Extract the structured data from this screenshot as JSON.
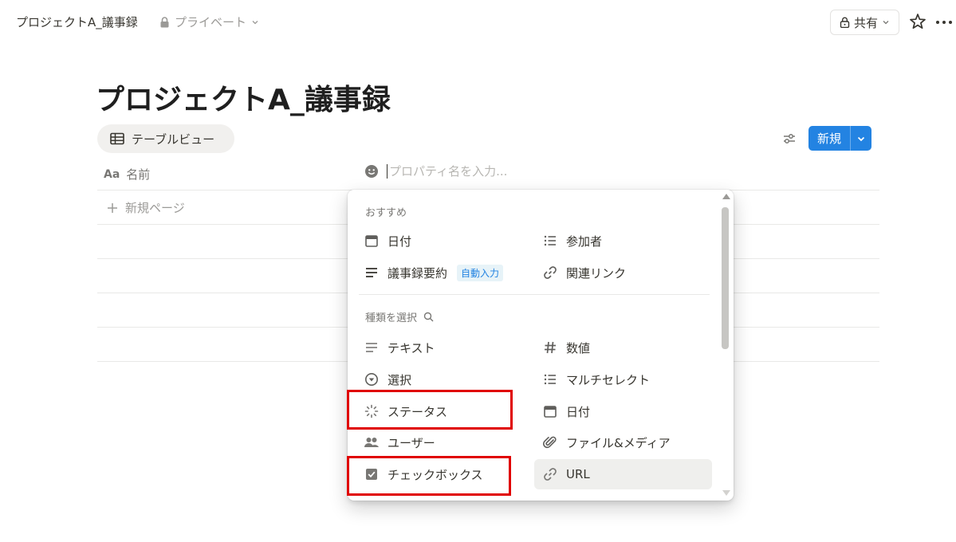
{
  "topbar": {
    "breadcrumb_title": "プロジェクトA_議事録",
    "privacy_label": "プライベート",
    "share_label": "共有"
  },
  "page": {
    "title": "プロジェクトA_議事録"
  },
  "view": {
    "tab_label": "テーブルビュー",
    "new_label": "新規"
  },
  "table": {
    "name_column": "名前",
    "name_column_icon_text": "Aa",
    "property_input_placeholder": "プロパティ名を入力...",
    "new_page_label": "新規ページ"
  },
  "menu": {
    "recommended_heading": "おすすめ",
    "recommended": [
      {
        "label": "日付",
        "icon": "calendar-icon"
      },
      {
        "label": "参加者",
        "icon": "list-icon"
      },
      {
        "label": "議事録要約",
        "icon": "text-lines-icon",
        "badge": "自動入力"
      },
      {
        "label": "関連リンク",
        "icon": "link-icon"
      }
    ],
    "types_heading": "種類を選択",
    "types": [
      {
        "label": "テキスト",
        "icon": "text-lines-icon"
      },
      {
        "label": "数値",
        "icon": "hash-icon"
      },
      {
        "label": "選択",
        "icon": "select-icon"
      },
      {
        "label": "マルチセレクト",
        "icon": "list-icon"
      },
      {
        "label": "ステータス",
        "icon": "status-icon"
      },
      {
        "label": "日付",
        "icon": "calendar-icon"
      },
      {
        "label": "ユーザー",
        "icon": "people-icon"
      },
      {
        "label": "ファイル&メディア",
        "icon": "paperclip-icon"
      },
      {
        "label": "チェックボックス",
        "icon": "checkbox-icon"
      },
      {
        "label": "URL",
        "icon": "link-icon"
      }
    ]
  },
  "colors": {
    "accent": "#2383e2",
    "highlight_box": "#e00000"
  }
}
